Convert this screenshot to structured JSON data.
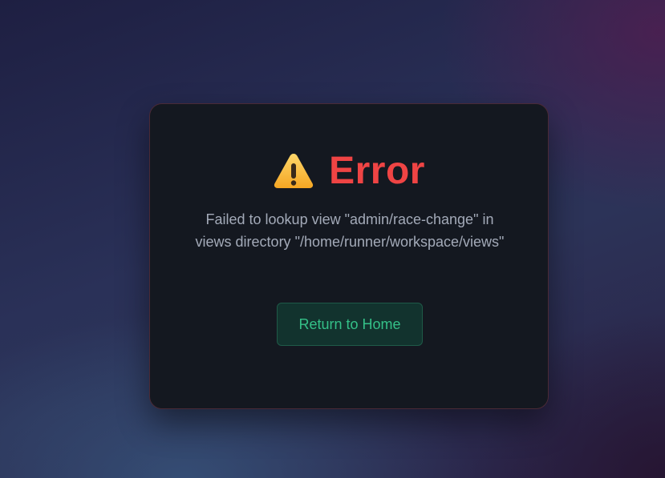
{
  "error": {
    "icon": "warning-icon",
    "title": "Error",
    "message": "Failed to lookup view \"admin/race-change\" in views directory \"/home/runner/workspace/views\"",
    "home_button_label": "Return to Home"
  },
  "colors": {
    "title": "#ef4444",
    "message": "#a3aab8",
    "button_text": "#34c088",
    "button_bg": "#12332e",
    "card_bg": "#141820"
  }
}
